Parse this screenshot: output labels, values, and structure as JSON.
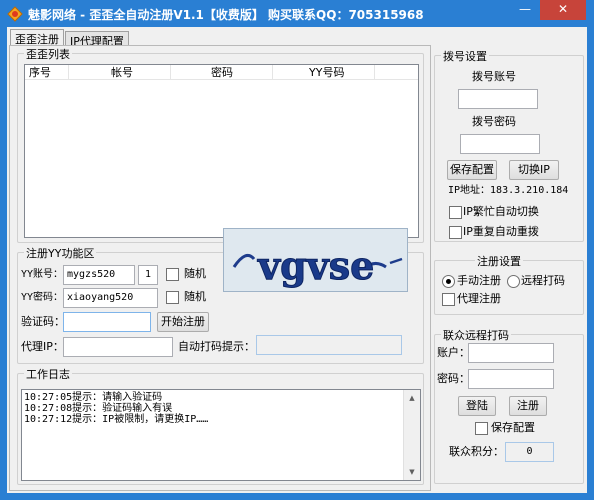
{
  "window": {
    "title": "魅影网络 - 歪歪全自动注册V1.1【收费版】  购买联系QQ：705315968",
    "minimize_glyph": "—",
    "close_glyph": "✕"
  },
  "tabs": [
    {
      "label": "歪歪注册",
      "active": true
    },
    {
      "label": "IP代理配置",
      "active": false
    }
  ],
  "account_list": {
    "legend": "歪歪列表",
    "columns": [
      "序号",
      "帐号",
      "密码",
      "YY号码"
    ]
  },
  "register": {
    "legend": "注册YY功能区",
    "yy_account_label": "YY账号：",
    "yy_account_value": "mygzs520",
    "count_value": "1",
    "random1_label": "随机",
    "yy_password_label": "YY密码：",
    "yy_password_value": "xiaoyang520",
    "random2_label": "随机",
    "captcha_label": "验证码：",
    "captcha_value": "",
    "start_button": "开始注册",
    "proxy_ip_label": "代理IP：",
    "proxy_ip_value": "",
    "auto_captcha_label": "自动打码提示：",
    "auto_captcha_value": "",
    "captcha_image_text": "vgvse"
  },
  "log": {
    "legend": "工作日志",
    "lines": [
      "10:27:05提示：请输入验证码",
      "10:27:08提示：验证码输入有误",
      "10:27:12提示：IP被限制，请更换IP……"
    ]
  },
  "dial": {
    "legend": "拨号设置",
    "account_label": "拨号账号",
    "account_value": "",
    "password_label": "拨号密码",
    "password_value": "",
    "save_button": "保存配置",
    "switch_ip_button": "切换IP",
    "ip_address": "IP地址：183.3.210.184",
    "busy_switch_label": "IP繁忙自动切换",
    "repeat_redial_label": "IP重复自动重拨"
  },
  "reg_settings": {
    "legend": "注册设置",
    "manual_label": "手动注册",
    "remote_label": "远程打码",
    "proxy_label": "代理注册",
    "selected": "manual"
  },
  "remote": {
    "legend": "联众远程打码",
    "account_label": "账户：",
    "account_value": "",
    "password_label": "密码：",
    "password_value": "",
    "login_button": "登陆",
    "register_button": "注册",
    "save_label": "保存配置",
    "points_label": "联众积分：",
    "points_value": "0"
  }
}
